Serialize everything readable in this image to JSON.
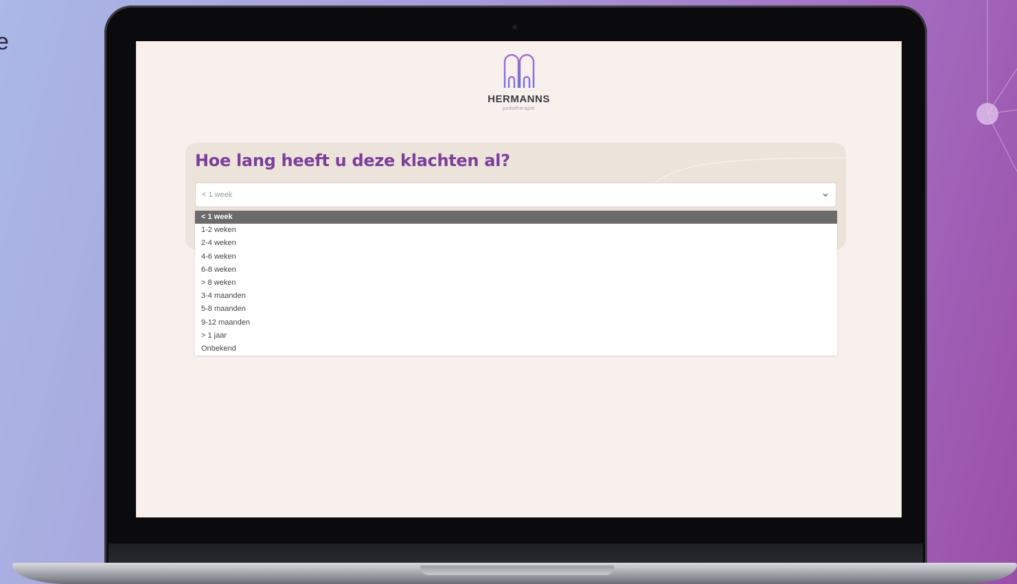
{
  "background": {
    "edge_text": "e",
    "gradient_colors": [
      "#aab9e6",
      "#a46fc2",
      "#9a4ea8"
    ]
  },
  "brand": {
    "name": "HERMANNS",
    "subtitle": "podotherapie",
    "logo_icon": "double-arch-icon",
    "accent_color": "#7b3f9a"
  },
  "form": {
    "question": "Hoe lang heeft u deze klachten al?",
    "select": {
      "value": "< 1 week",
      "icon": "chevron-down-icon"
    },
    "options": [
      "< 1 week",
      "1-2 weken",
      "2-4 weken",
      "4-6 weken",
      "6-8 weken",
      "> 8 weken",
      "3-4 maanden",
      "5-8 maanden",
      "9-12 maanden",
      "> 1 jaar",
      "Onbekend"
    ],
    "selected_option": "< 1 week"
  }
}
